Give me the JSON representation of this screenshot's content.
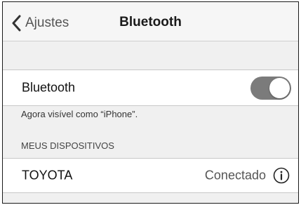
{
  "nav": {
    "back_label": "Ajustes",
    "title": "Bluetooth"
  },
  "bluetooth_row": {
    "label": "Bluetooth",
    "toggle_on": true
  },
  "visibility_note": "Agora visível como “iPhone”.",
  "devices_section": {
    "header": "MEUS DISPOSITIVOS",
    "devices": [
      {
        "name": "TOYOTA",
        "status": "Conectado",
        "icon": "info-icon"
      }
    ]
  },
  "colors": {
    "toggle_track": "#7b7b7b",
    "background": "#f0f0f0",
    "cell": "#ffffff"
  }
}
